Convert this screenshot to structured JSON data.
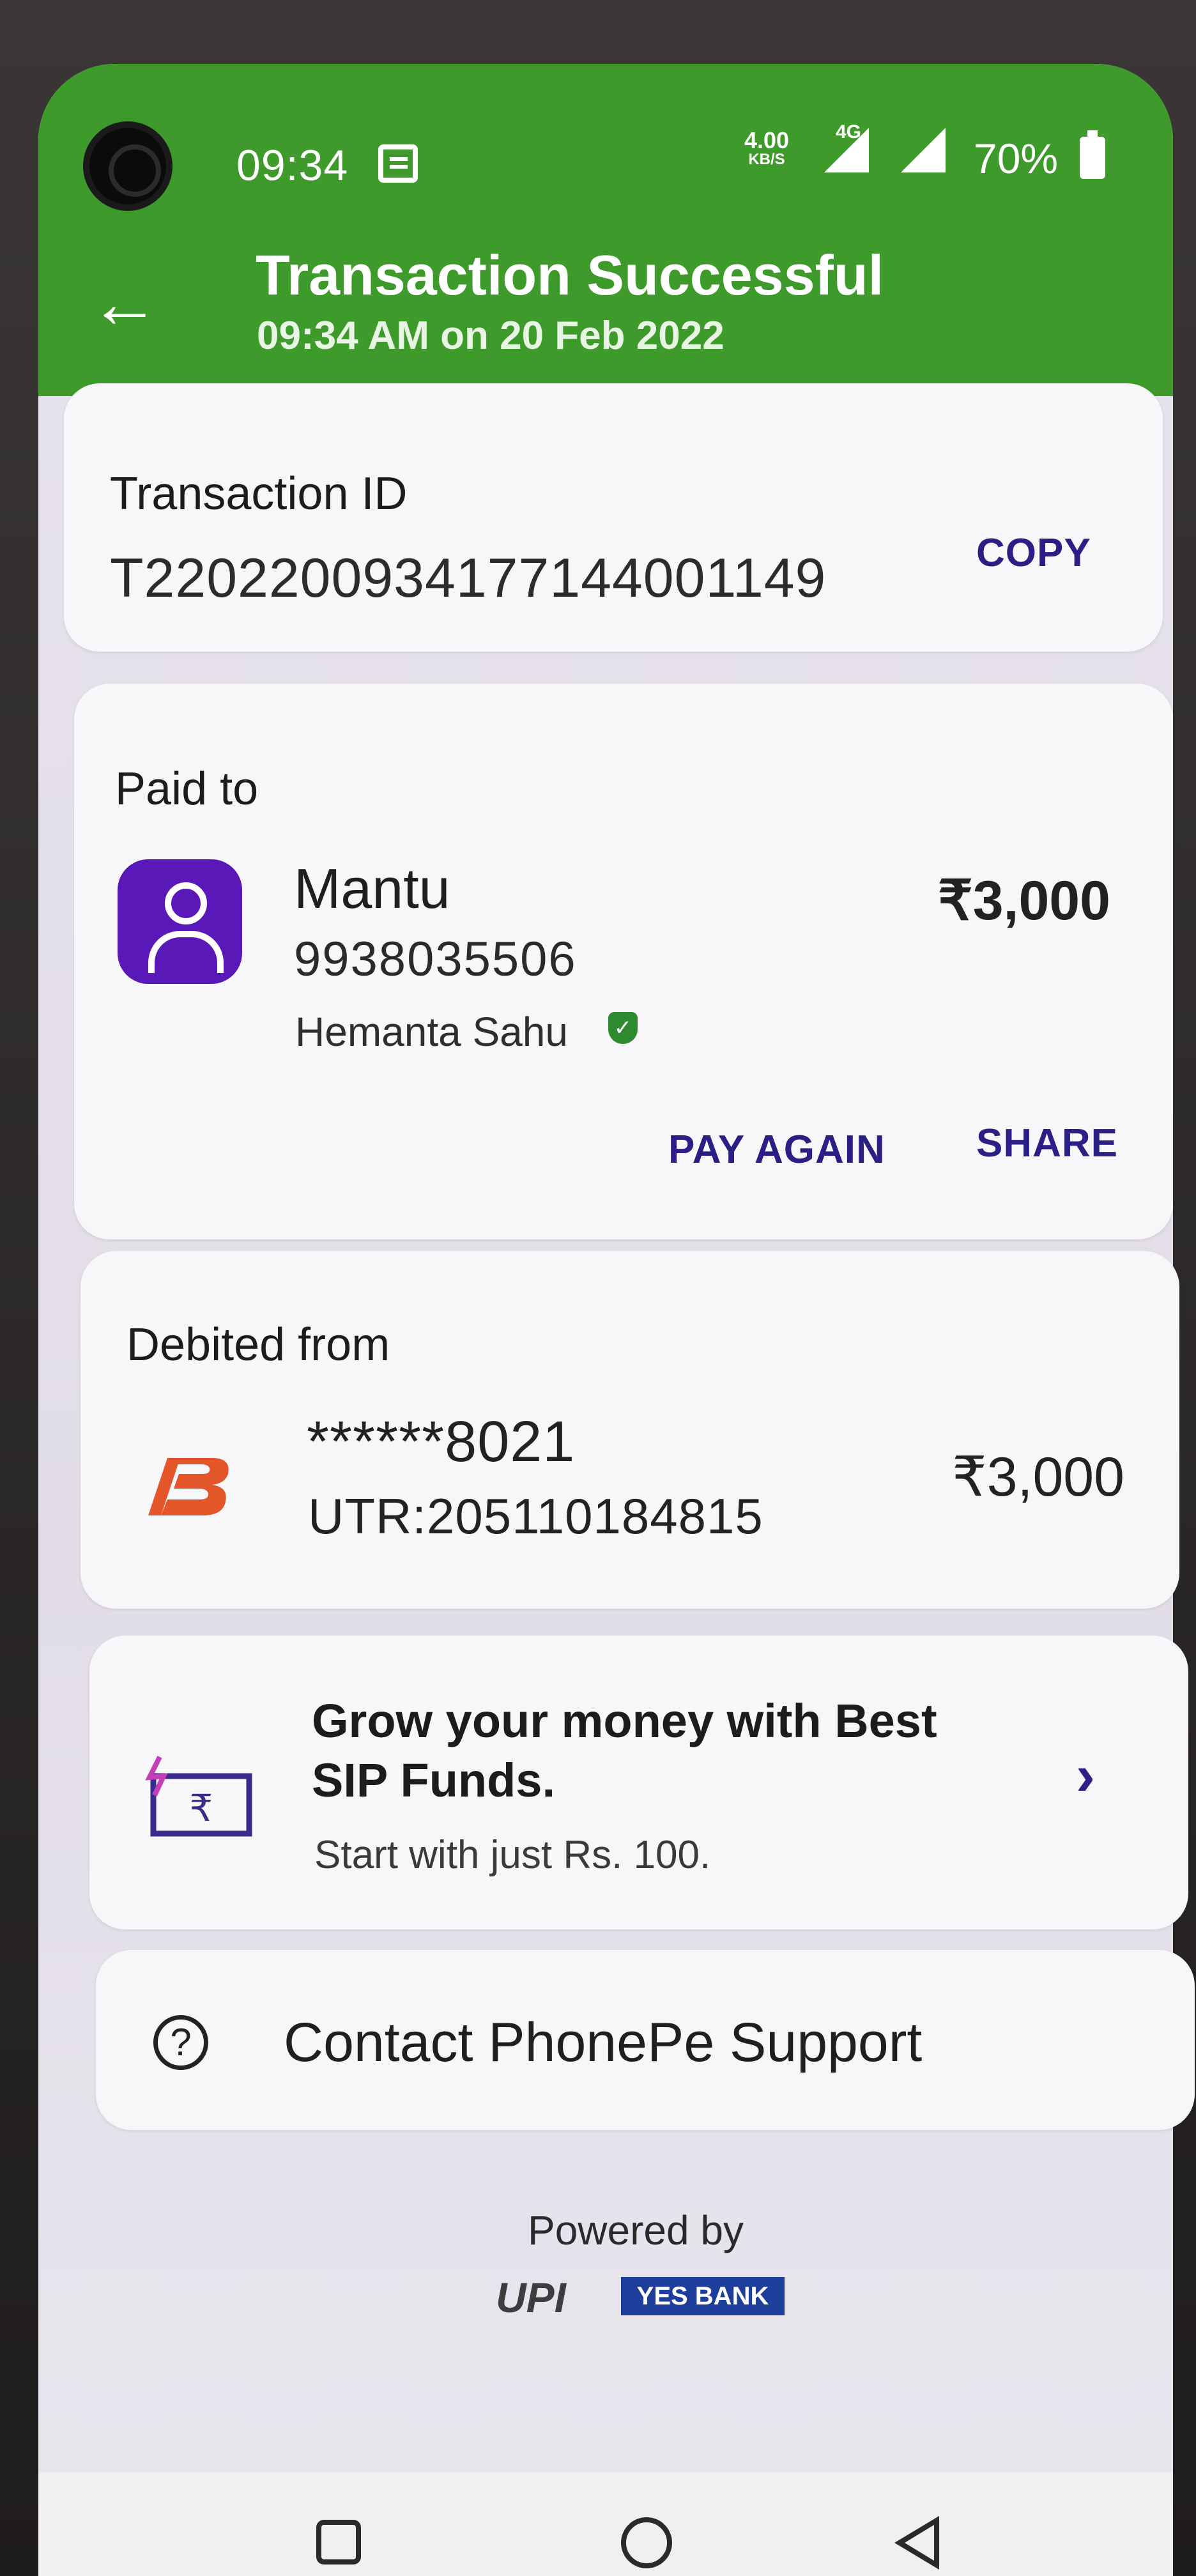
{
  "status_bar": {
    "time": "09:34",
    "speed_value": "4.00",
    "speed_unit": "KB/S",
    "network": "4G",
    "battery": "70%"
  },
  "header": {
    "title": "Transaction Successful",
    "subtitle": "09:34 AM on 20 Feb 2022"
  },
  "transaction": {
    "label": "Transaction ID",
    "id": "T2202200934177144001149",
    "copy_label": "COPY"
  },
  "paid_to": {
    "label": "Paid to",
    "name": "Mantu",
    "phone": "9938035506",
    "legal_name": "Hemanta  Sahu",
    "amount": "₹3,000",
    "pay_again_label": "PAY AGAIN",
    "share_label": "SHARE"
  },
  "debited_from": {
    "label": "Debited from",
    "account": "******8021",
    "utr": "UTR:205110184815",
    "amount": "₹3,000"
  },
  "promo": {
    "title_line1": "Grow your money with Best",
    "title_line2": "SIP Funds.",
    "subtitle": "Start with just Rs. 100."
  },
  "support": {
    "label": "Contact PhonePe Support"
  },
  "footer": {
    "powered_by": "Powered by",
    "upi_logo": "UPI",
    "bank_logo": "YES BANK"
  },
  "colors": {
    "header_green": "#3e9a2a",
    "accent_purple": "#2b1f86",
    "avatar_purple": "#5b18b8",
    "verified_green": "#2e8a2e"
  }
}
